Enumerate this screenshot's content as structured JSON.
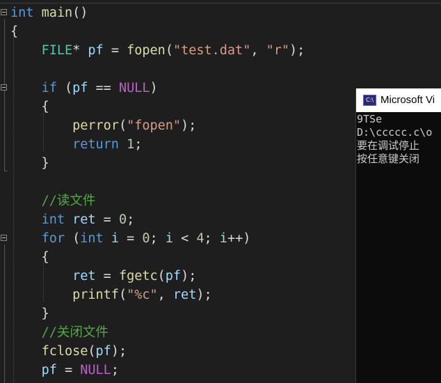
{
  "editor": {
    "lines": [
      {
        "tokens": [
          {
            "t": "int",
            "c": "kw"
          },
          {
            "t": " ",
            "c": "pl"
          },
          {
            "t": "main",
            "c": "fn"
          },
          {
            "t": "()",
            "c": "pl"
          }
        ]
      },
      {
        "tokens": [
          {
            "t": "{",
            "c": "pl"
          }
        ]
      },
      {
        "tokens": [
          {
            "t": "    ",
            "c": "pl"
          },
          {
            "t": "FILE",
            "c": "ty"
          },
          {
            "t": "* ",
            "c": "pl"
          },
          {
            "t": "pf",
            "c": "vr"
          },
          {
            "t": " = ",
            "c": "pl"
          },
          {
            "t": "fopen",
            "c": "fn"
          },
          {
            "t": "(",
            "c": "pl"
          },
          {
            "t": "\"test.dat\"",
            "c": "str"
          },
          {
            "t": ", ",
            "c": "pl"
          },
          {
            "t": "\"r\"",
            "c": "str"
          },
          {
            "t": ");",
            "c": "pl"
          }
        ]
      },
      {
        "tokens": []
      },
      {
        "tokens": [
          {
            "t": "    ",
            "c": "pl"
          },
          {
            "t": "if",
            "c": "kw"
          },
          {
            "t": " (",
            "c": "pl"
          },
          {
            "t": "pf",
            "c": "vr"
          },
          {
            "t": " == ",
            "c": "pl"
          },
          {
            "t": "NULL",
            "c": "mac"
          },
          {
            "t": ")",
            "c": "pl"
          }
        ]
      },
      {
        "tokens": [
          {
            "t": "    {",
            "c": "pl"
          }
        ]
      },
      {
        "tokens": [
          {
            "t": "        ",
            "c": "pl"
          },
          {
            "t": "perror",
            "c": "fn"
          },
          {
            "t": "(",
            "c": "pl"
          },
          {
            "t": "\"fopen\"",
            "c": "str"
          },
          {
            "t": ");",
            "c": "pl"
          }
        ]
      },
      {
        "tokens": [
          {
            "t": "        ",
            "c": "pl"
          },
          {
            "t": "return",
            "c": "kw"
          },
          {
            "t": " ",
            "c": "pl"
          },
          {
            "t": "1",
            "c": "num"
          },
          {
            "t": ";",
            "c": "pl"
          }
        ]
      },
      {
        "tokens": [
          {
            "t": "    }",
            "c": "pl"
          }
        ]
      },
      {
        "tokens": []
      },
      {
        "tokens": [
          {
            "t": "    ",
            "c": "pl"
          },
          {
            "t": "//读文件",
            "c": "cm"
          }
        ]
      },
      {
        "tokens": [
          {
            "t": "    ",
            "c": "pl"
          },
          {
            "t": "int",
            "c": "kw"
          },
          {
            "t": " ",
            "c": "pl"
          },
          {
            "t": "ret",
            "c": "vr"
          },
          {
            "t": " = ",
            "c": "pl"
          },
          {
            "t": "0",
            "c": "num"
          },
          {
            "t": ";",
            "c": "pl"
          }
        ]
      },
      {
        "tokens": [
          {
            "t": "    ",
            "c": "pl"
          },
          {
            "t": "for",
            "c": "kw"
          },
          {
            "t": " (",
            "c": "pl"
          },
          {
            "t": "int",
            "c": "kw"
          },
          {
            "t": " ",
            "c": "pl"
          },
          {
            "t": "i",
            "c": "vr"
          },
          {
            "t": " = ",
            "c": "pl"
          },
          {
            "t": "0",
            "c": "num"
          },
          {
            "t": "; ",
            "c": "pl"
          },
          {
            "t": "i",
            "c": "vr"
          },
          {
            "t": " < ",
            "c": "pl"
          },
          {
            "t": "4",
            "c": "num"
          },
          {
            "t": "; ",
            "c": "pl"
          },
          {
            "t": "i",
            "c": "vr"
          },
          {
            "t": "++)",
            "c": "pl"
          }
        ]
      },
      {
        "tokens": [
          {
            "t": "    {",
            "c": "pl"
          }
        ]
      },
      {
        "tokens": [
          {
            "t": "        ",
            "c": "pl"
          },
          {
            "t": "ret",
            "c": "vr"
          },
          {
            "t": " = ",
            "c": "pl"
          },
          {
            "t": "fgetc",
            "c": "fn"
          },
          {
            "t": "(",
            "c": "pl"
          },
          {
            "t": "pf",
            "c": "vr"
          },
          {
            "t": ");",
            "c": "pl"
          }
        ]
      },
      {
        "tokens": [
          {
            "t": "        ",
            "c": "pl"
          },
          {
            "t": "printf",
            "c": "fn"
          },
          {
            "t": "(",
            "c": "pl"
          },
          {
            "t": "\"%c\"",
            "c": "str"
          },
          {
            "t": ", ",
            "c": "pl"
          },
          {
            "t": "ret",
            "c": "vr"
          },
          {
            "t": ");",
            "c": "pl"
          }
        ]
      },
      {
        "tokens": [
          {
            "t": "    }",
            "c": "pl"
          }
        ]
      },
      {
        "tokens": [
          {
            "t": "    ",
            "c": "pl"
          },
          {
            "t": "//关闭文件",
            "c": "cm"
          }
        ]
      },
      {
        "tokens": [
          {
            "t": "    ",
            "c": "pl"
          },
          {
            "t": "fclose",
            "c": "fn"
          },
          {
            "t": "(",
            "c": "pl"
          },
          {
            "t": "pf",
            "c": "vr"
          },
          {
            "t": ");",
            "c": "pl"
          }
        ]
      },
      {
        "tokens": [
          {
            "t": "    ",
            "c": "pl"
          },
          {
            "t": "pf",
            "c": "vr"
          },
          {
            "t": " = ",
            "c": "pl"
          },
          {
            "t": "NULL",
            "c": "mac"
          },
          {
            "t": ";",
            "c": "pl"
          }
        ]
      }
    ]
  },
  "console": {
    "title": "Microsoft Vi",
    "icon": "console-app-icon",
    "icon_text": "C:\\",
    "lines": [
      "9TSe",
      "D:\\ccccc.c\\o",
      "要在调试停止",
      "按任意键关闭"
    ]
  },
  "colors": {
    "keyword": "#569cd6",
    "type": "#4ec9b0",
    "function": "#dcdcaa",
    "variable": "#9cdcfe",
    "string": "#d69d85",
    "number": "#b5cea8",
    "comment": "#57a64a",
    "macro": "#bd63c5",
    "plain": "#dcdcdc",
    "editor_background": "#1e1e1e",
    "console_background": "#0c0c0c"
  }
}
